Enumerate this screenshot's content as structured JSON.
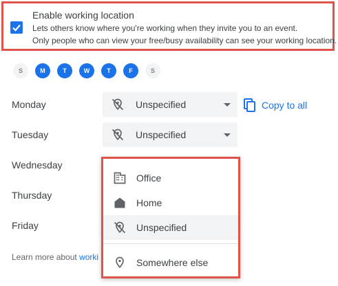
{
  "enable": {
    "checked": true,
    "title": "Enable working location",
    "desc_line1": "Lets others know where you're working when they invite you to an event.",
    "desc_line2": "Only people who can view your free/busy availability can see your working location."
  },
  "weekdays": [
    {
      "label": "S",
      "active": false
    },
    {
      "label": "M",
      "active": true
    },
    {
      "label": "T",
      "active": true
    },
    {
      "label": "W",
      "active": true
    },
    {
      "label": "T",
      "active": true
    },
    {
      "label": "F",
      "active": true
    },
    {
      "label": "S",
      "active": false
    }
  ],
  "rows": [
    {
      "day": "Monday",
      "value": "Unspecified"
    },
    {
      "day": "Tuesday",
      "value": "Unspecified"
    },
    {
      "day": "Wednesday"
    },
    {
      "day": "Thursday"
    },
    {
      "day": "Friday"
    }
  ],
  "copy_all_label": "Copy to all",
  "learn_more": {
    "prefix": "Learn more about ",
    "link": "worki"
  },
  "menu": {
    "items": [
      {
        "label": "Office",
        "icon": "office-building-icon"
      },
      {
        "label": "Home",
        "icon": "home-icon"
      },
      {
        "label": "Unspecified",
        "icon": "location-off-icon",
        "selected": true
      },
      {
        "label": "Somewhere else",
        "icon": "location-pin-icon"
      }
    ]
  },
  "colors": {
    "accent": "#1a73e8",
    "highlight_border": "#e0534a",
    "select_bg": "#f1f3f4"
  }
}
